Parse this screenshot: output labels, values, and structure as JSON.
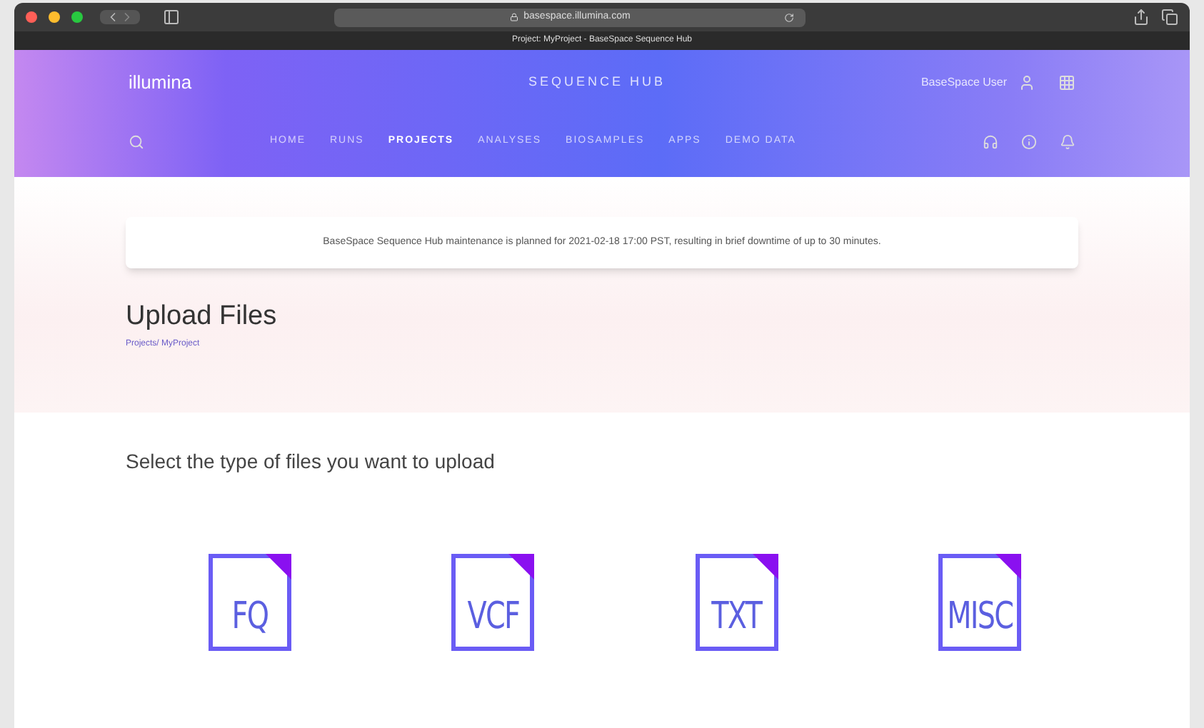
{
  "browser": {
    "url": "basespace.illumina.com",
    "tab_title": "Project: MyProject - BaseSpace Sequence Hub"
  },
  "header": {
    "logo": "illumina",
    "product": "SEQUENCE HUB",
    "user": "BaseSpace User"
  },
  "nav": [
    {
      "label": "HOME",
      "selected": false
    },
    {
      "label": "RUNS",
      "selected": false
    },
    {
      "label": "PROJECTS",
      "selected": true
    },
    {
      "label": "ANALYSES",
      "selected": false
    },
    {
      "label": "BIOSAMPLES",
      "selected": false
    },
    {
      "label": "APPS",
      "selected": false
    },
    {
      "label": "DEMO DATA",
      "selected": false
    }
  ],
  "notice": "BaseSpace Sequence Hub maintenance is planned for 2021-02-18 17:00 PST, resulting in brief downtime of up to 30 minutes.",
  "page": {
    "title": "Upload Files",
    "breadcrumb": "Projects/ MyProject"
  },
  "prompt": "Select the type of files you want to upload",
  "file_types": [
    {
      "label": "FQ"
    },
    {
      "label": "VCF"
    },
    {
      "label": "TXT"
    },
    {
      "label": "MISC"
    }
  ]
}
